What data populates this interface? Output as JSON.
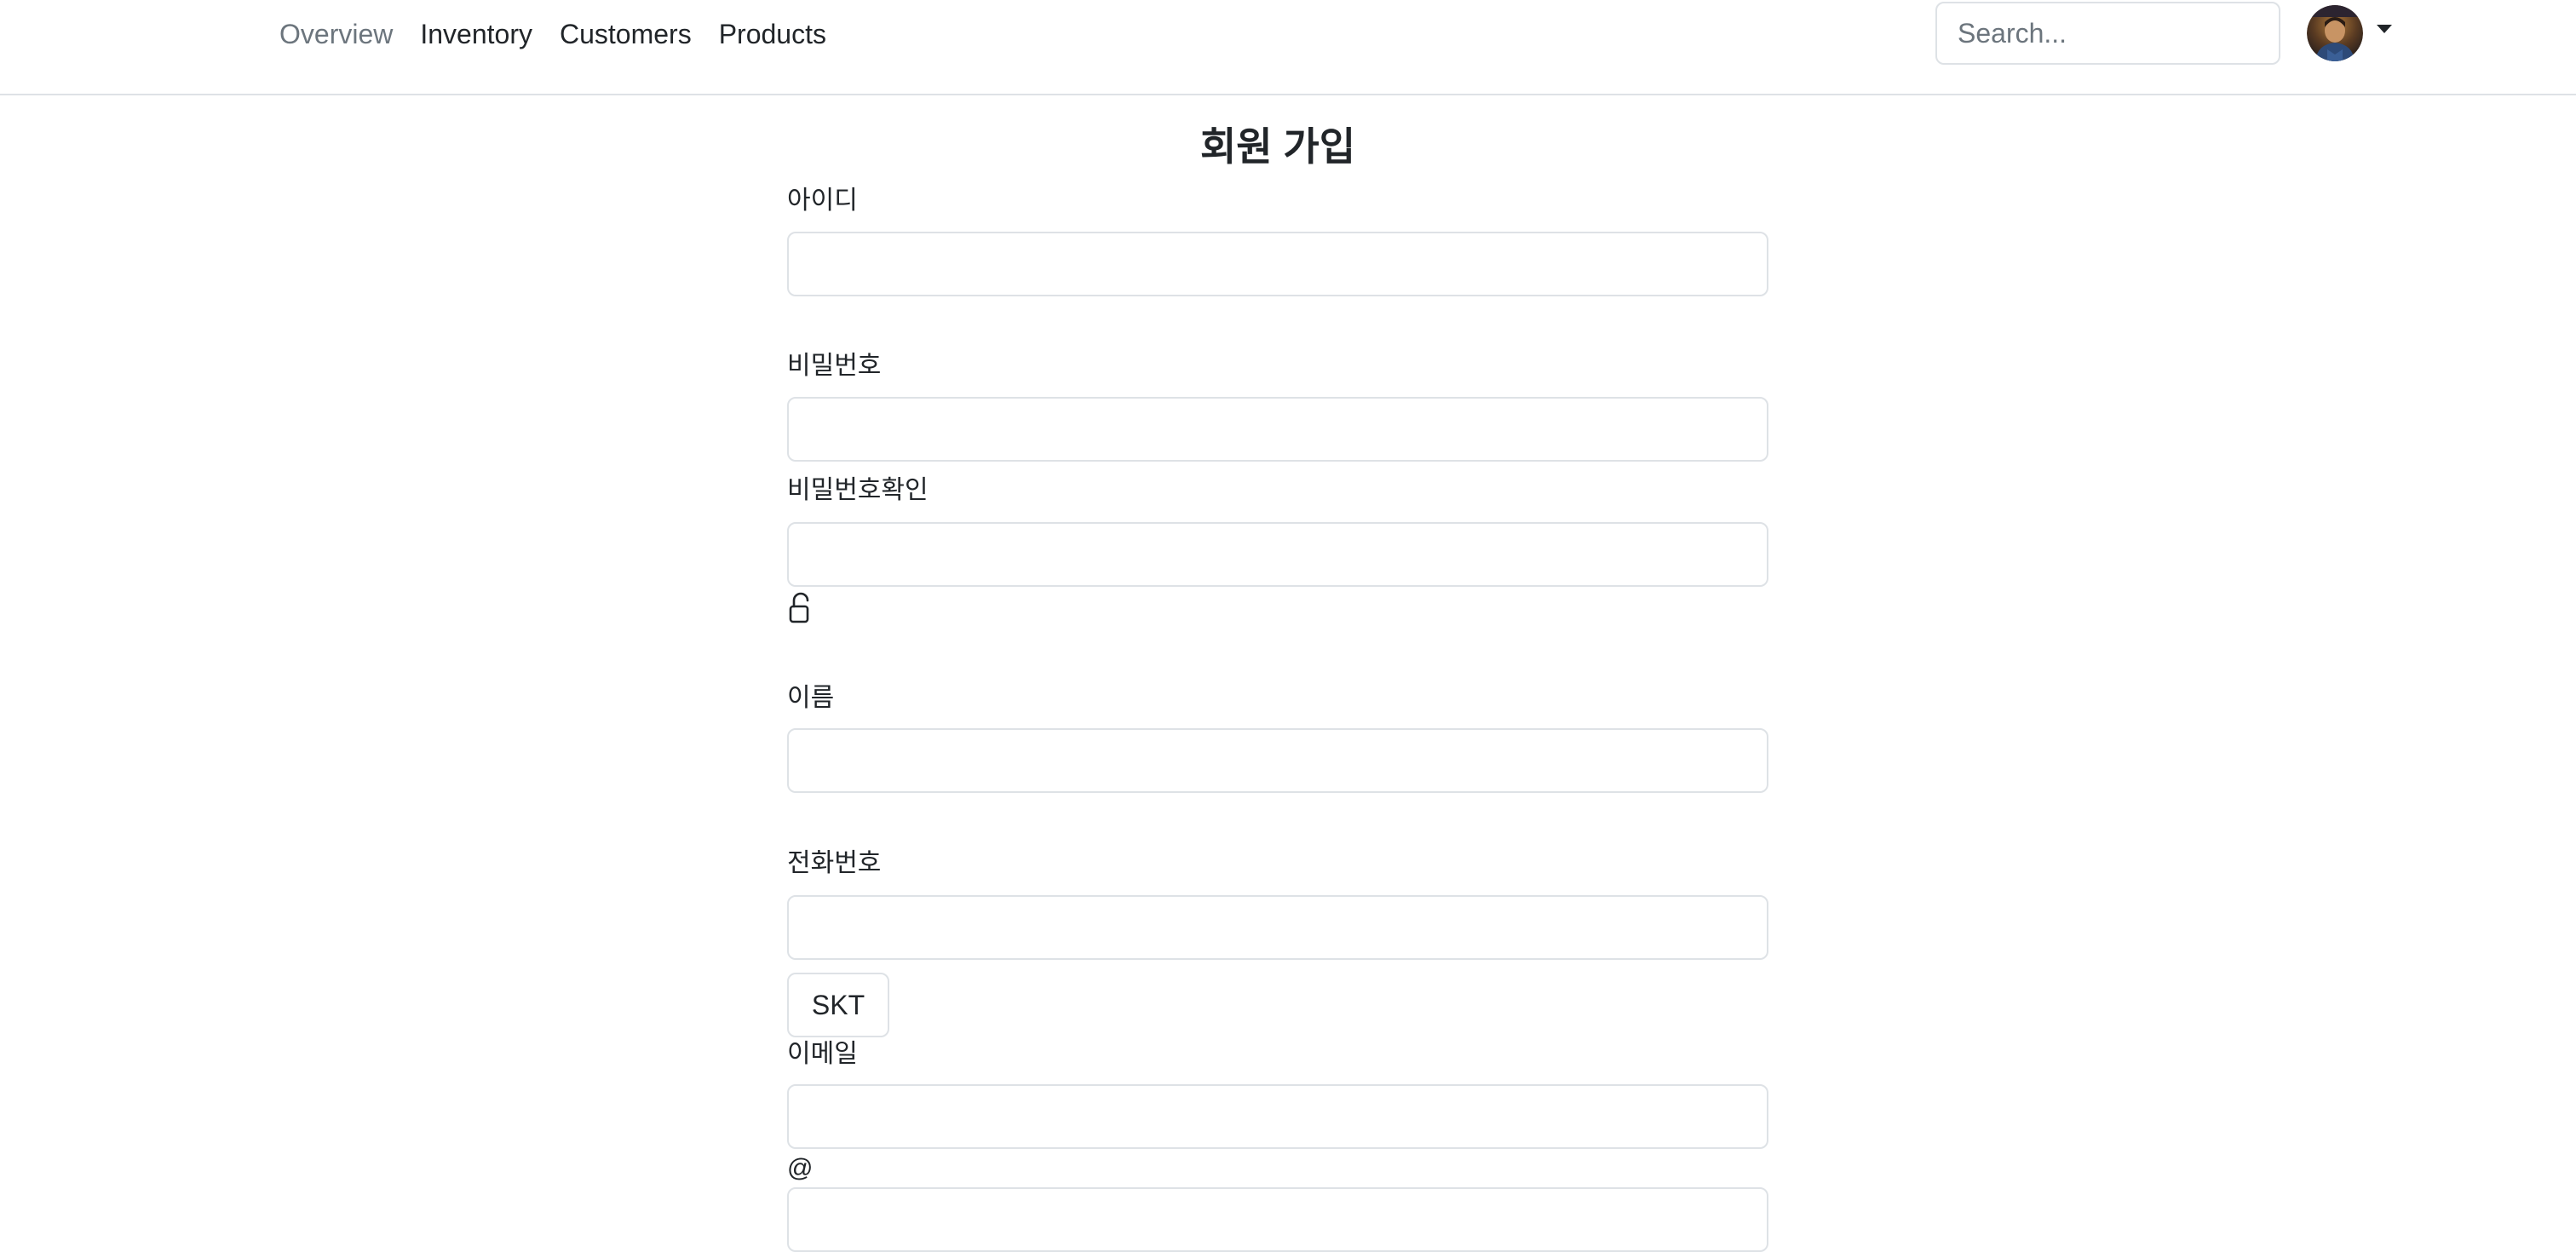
{
  "nav": {
    "items": [
      {
        "label": "Overview",
        "active": false
      },
      {
        "label": "Inventory"
      },
      {
        "label": "Customers"
      },
      {
        "label": "Products"
      }
    ]
  },
  "search": {
    "placeholder": "Search..."
  },
  "profile": {
    "avatar_icon": "user-avatar",
    "menu_icon": "caret-down-icon"
  },
  "form": {
    "title": "회원 가입",
    "fields": {
      "id": {
        "label": "아이디",
        "value": ""
      },
      "password": {
        "label": "비밀번호",
        "value": ""
      },
      "password_confirm": {
        "label": "비밀번호확인",
        "value": "",
        "icon": "lock-icon"
      },
      "name": {
        "label": "이름",
        "value": ""
      },
      "phone": {
        "label": "전화번호",
        "value": "",
        "carrier": "SKT"
      },
      "email": {
        "label": "이메일",
        "value": "",
        "at": "@"
      }
    }
  },
  "colors": {
    "text": "#212529",
    "muted": "#6c757d",
    "border": "#dee2e6"
  }
}
